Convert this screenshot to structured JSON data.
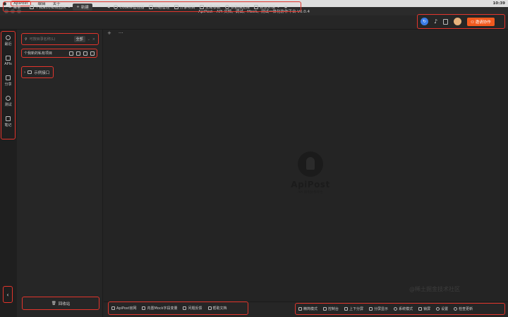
{
  "menubar": {
    "app_name": "ApiPost",
    "items": [
      "编辑",
      "关于"
    ],
    "clock": "10:39"
  },
  "window": {
    "title": "ApiPost - API 文档、调试、Mock、测试一体化协作平台 V6.0.4"
  },
  "toolbar": {
    "menu_label": "菜单",
    "team_label": "个我新的私有团队",
    "new_label": "新建",
    "more_label": "···",
    "back_label": "◀",
    "cookie_label": "Cookie管理器",
    "log_label": "日结管理",
    "share_label": "分享项目",
    "global_label": "全局参数",
    "db_label": "参数描述库",
    "env_label": "默认环境",
    "invite_label": "邀请协作"
  },
  "sidebar": {
    "items": [
      {
        "label": "最近",
        "icon": "clock-icon"
      },
      {
        "label": "APIs",
        "icon": "api-icon"
      },
      {
        "label": "分享",
        "icon": "share-icon"
      },
      {
        "label": "测试",
        "icon": "test-icon"
      },
      {
        "label": "笔记",
        "icon": "note-icon"
      }
    ],
    "collapse_label": "‹"
  },
  "panel": {
    "search_placeholder": "可按目录名称(L)",
    "search_filter": "全部",
    "project_label": "个我新的私有项目",
    "example_label": "示例接口",
    "recycle_label": "回收站"
  },
  "tabstrip": {
    "add_label": "+",
    "more_label": "···"
  },
  "logo": {
    "name": "ApiPost",
    "subtitle": "API 研发协作平台"
  },
  "bottom_left": [
    "ApiPost官网",
    "内置Mock字段变量",
    "问题反馈",
    "帮助文档"
  ],
  "bottom_right": [
    "精简模式",
    "控制台",
    "上下分屏",
    "分屏显示",
    "系统模式",
    "锁屏",
    "设置",
    "检查更新"
  ],
  "watermark": "@稀土掘金技术社区"
}
